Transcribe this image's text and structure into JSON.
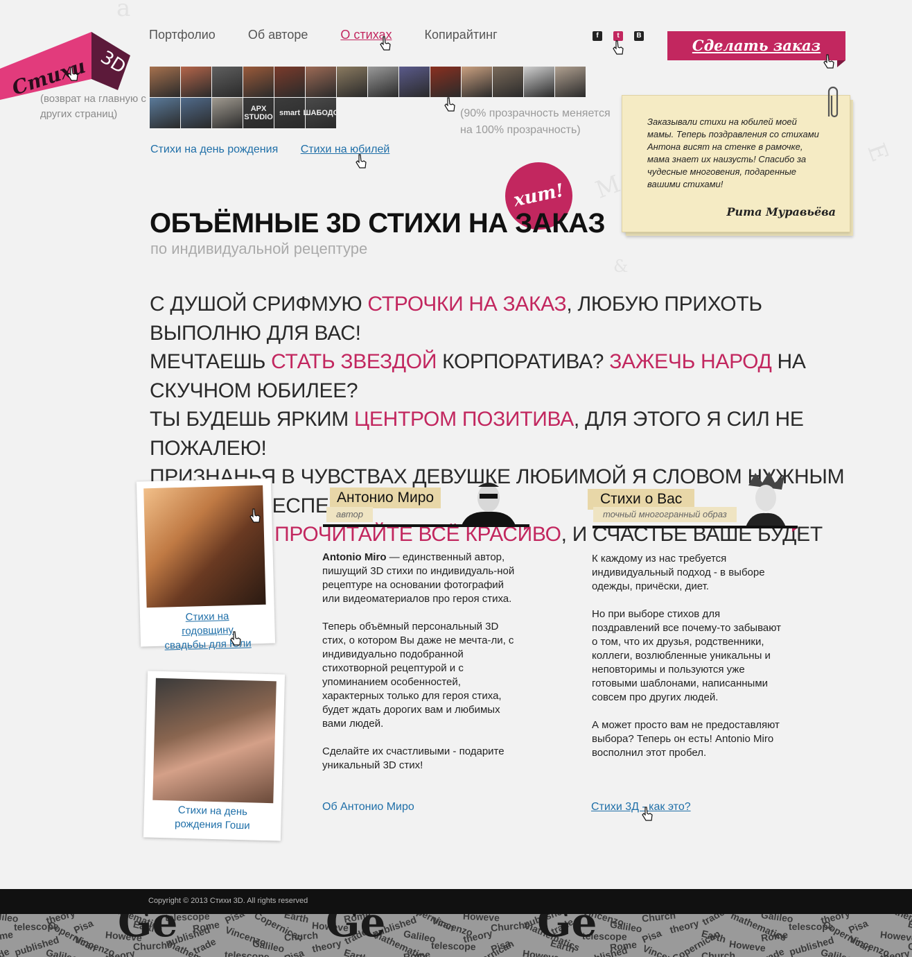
{
  "logo": {
    "text": "Стихи",
    "badge": "3D",
    "subtitle": "(возврат на главную с других страниц)"
  },
  "nav": {
    "items": [
      {
        "label": "Портфолио",
        "active": false
      },
      {
        "label": "Об авторе",
        "active": false
      },
      {
        "label": "О стихах",
        "active": true
      },
      {
        "label": "Копирайтинг",
        "active": false
      }
    ]
  },
  "social": {
    "items": [
      {
        "icon": "facebook-icon",
        "glyph": "f"
      },
      {
        "icon": "twitter-icon",
        "glyph": "t"
      },
      {
        "icon": "vkontakte-icon",
        "glyph": "B"
      }
    ]
  },
  "order_button": {
    "label": "Сделать заказ"
  },
  "strip": {
    "note": "(90% прозрачность меняется на 100% прозрачность)",
    "thumbs_row1_colors": [
      "#a6714e",
      "#b4654a",
      "#5f5f5f",
      "#9a5a3a",
      "#7b3b2b",
      "#9c6a55",
      "#8a7a60",
      "#999999",
      "#5a5a8a",
      "#8a3020",
      "#caa080",
      "#7a6a5a",
      "#cfcfcf",
      "#b0a090"
    ],
    "thumbs_row2_colors": [
      "#5a7a9a",
      "#506a8a",
      "#a09a90",
      "#3a3a3a",
      "#3c3c3c",
      "#4a4a4a"
    ],
    "logo_labels": [
      "APX STUDIO",
      "smart",
      "ШАБОДС"
    ]
  },
  "sublinks": {
    "birthday": "Стихи на день рождения",
    "jubilee": "Стихи на юбилей"
  },
  "testimonial": {
    "text": "Заказывали стихи на юбилей моей мамы. Теперь поздравления со стихами Антона висят на стенке в рамочке, мама знает их наизусть! Спасибо за чудесные многовения, подаренные вашими стихами!",
    "author": "Рита Муравьёва"
  },
  "hit_badge": "хит!",
  "headline": "ОБЪЁМНЫЕ 3D СТИХИ НА ЗАКАЗ",
  "subheadline": "по индивидуальной рецептуре",
  "poem": [
    [
      {
        "t": "С душой срифмую "
      },
      {
        "t": "строчки на заказ",
        "hl": true
      },
      {
        "t": ", любую прихоть выполню для вас!"
      }
    ],
    [
      {
        "t": "Мечтаешь "
      },
      {
        "t": "стать звездой",
        "hl": true
      },
      {
        "t": " корпоратива? "
      },
      {
        "t": "Зажечь народ",
        "hl": true
      },
      {
        "t": " на скучном юбилее?"
      }
    ],
    [
      {
        "t": "Ты будешь ярким "
      },
      {
        "t": "центром позитива",
        "hl": true
      },
      {
        "t": ", для этого я сил не пожалею!"
      }
    ],
    [
      {
        "t": "Признанья в чувствах девушке любимой я словом нужным быстро обеспечу."
      }
    ],
    [
      {
        "t": "Вы только "
      },
      {
        "t": "прочитайте всё красиво",
        "hl": true
      },
      {
        "t": ", и счастье ваше будет вечным!"
      }
    ]
  ],
  "polaroids": [
    {
      "caption": "Стихи на годовщину свадьбы для Юли"
    },
    {
      "caption": "Стихи на день рождения Гоши"
    }
  ],
  "author_col": {
    "title": "Антонио Миро",
    "sub": "автор",
    "name_bold": "Antonio Miro",
    "p1_rest": " — единственный автор, пишущий 3D стихи по индивидуаль-ной рецептуре на основании фотографий или видеоматериалов про героя стиха.",
    "p2": "Теперь объёмный персональный 3D стих, о котором Вы даже не мечта-ли, с индивидуально подобранной стихотворной рецептурой и с упоминанием особенностей, характерных только для героя стиха, будет ждать дорогих вам и любимых вами людей.",
    "p3": "Сделайте их счастливыми - подарите уникальный 3D стих!",
    "link": "Об Антонио Миро"
  },
  "about_col": {
    "title": "Стихи о Вас",
    "sub": "точный многогранный образ",
    "p1": "К каждому из нас требуется индивидуальный подход - в выборе одежды,  причёски, диет.",
    "p2": "Но при выборе стихов для поздравлений все почему-то забывают о том, что их друзья, родственники, коллеги, возлюбленные уникальны и неповторимы и пользуются уже готовыми шаблонами, написанными совсем про других людей.",
    "p3": "А может просто вам не предоставляют выбора? Теперь он есть! Antonio Miro восполнил этот пробел.",
    "link": "Стихи 3Д - как это?"
  },
  "footer": {
    "copyright": "Copyright © 2013 Стихи 3D. All rights reserved",
    "pattern_words": [
      "Galileo",
      "theory",
      "mathematics",
      "telescope",
      "Pisa",
      "Earth",
      "Rome",
      "Copernican",
      "Howeve",
      "published",
      "Vincenzo",
      "Church",
      "trade"
    ]
  },
  "colors": {
    "accent": "#c2275f",
    "link": "#1f6fa8",
    "note": "#f5ebc4",
    "tag": "#e8d7a8"
  }
}
